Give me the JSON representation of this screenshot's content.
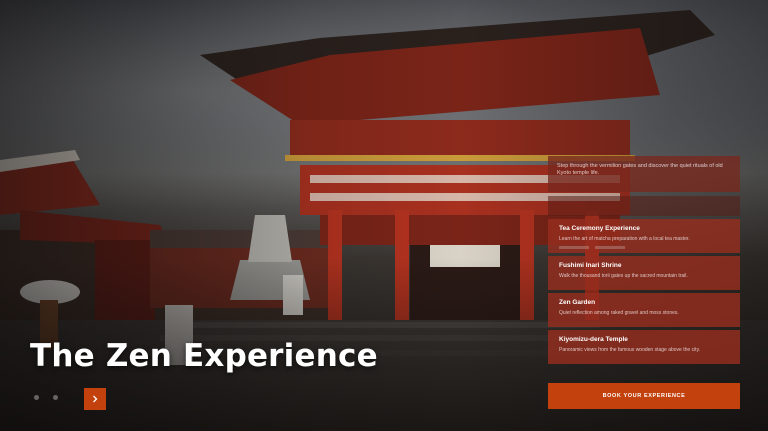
{
  "hero": {
    "title": "The Zen Experience",
    "slide_count": 3,
    "active_slide": 3
  },
  "panel": {
    "intro": "Step through the vermilion gates and discover the quiet rituals of old Kyoto temple life.",
    "cards": [
      {
        "title": "Tea Ceremony Experience",
        "desc": "Learn the art of matcha preparation with a local tea master."
      },
      {
        "title": "Fushimi Inari Shrine",
        "desc": "Walk the thousand torii gates up the sacred mountain trail."
      },
      {
        "title": "Zen Garden",
        "desc": "Quiet reflection among raked gravel and moss stones."
      },
      {
        "title": "Kiyomizu-dera Temple",
        "desc": "Panoramic views from the famous wooden stage above the city."
      }
    ]
  },
  "cta": {
    "label": "BOOK YOUR EXPERIENCE"
  },
  "colors": {
    "accent": "#c2410c",
    "panel": "#962d1e",
    "gate_red": "#b3321f"
  }
}
